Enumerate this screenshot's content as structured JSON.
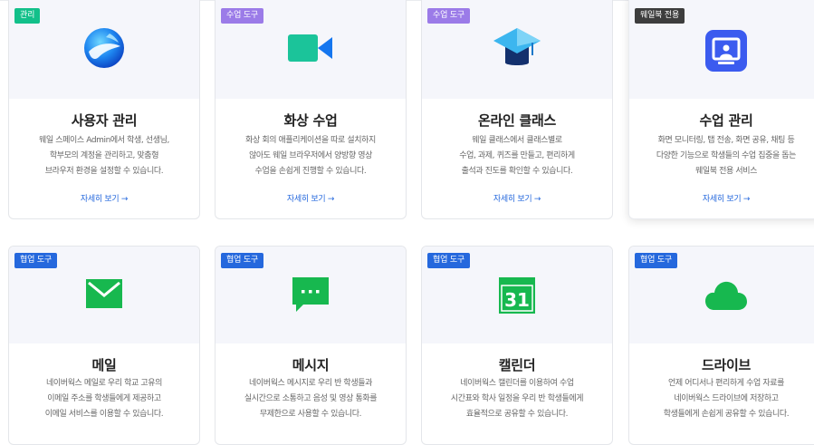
{
  "colors": {
    "badge_green": "#12c08a",
    "badge_purple": "#9b7be8",
    "badge_dark": "#3d3d3d",
    "badge_blue": "#2568dd",
    "link": "#2568dd",
    "green_icon": "#17b84f",
    "zoom_teal": "#1bc49a",
    "zoom_blue": "#1576ef",
    "classroom_blue": "#3cb6ef",
    "classroom_navy": "#13306d",
    "monitor_blue": "#3b5bef"
  },
  "cards_top": [
    {
      "badge": "관리",
      "icon": "whale-icon",
      "title": "사용자 관리",
      "desc": [
        "웨일 스페이스 Admin에서 학생, 선생님,",
        "학부모의 계정을 관리하고, 맞춤형",
        "브라우저 환경을 설정할 수 있습니다."
      ],
      "more": "자세히 보기 →"
    },
    {
      "badge": "수업 도구",
      "icon": "video-camera-icon",
      "title": "화상 수업",
      "desc": [
        "화상 회의 애플리케이션을 따로 설치하지",
        "않아도 웨일 브라우저에서 양방향 영상",
        "수업을 손쉽게 진행할 수 있습니다."
      ],
      "more": "자세히 보기 →"
    },
    {
      "badge": "수업 도구",
      "icon": "graduation-cap-icon",
      "title": "온라인 클래스",
      "desc": [
        "웨일 클래스에서 클래스별로",
        "수업, 과제, 퀴즈를 만들고, 편리하게",
        "출석과 진도를 확인할 수 있습니다."
      ],
      "more": "자세히 보기 →"
    },
    {
      "badge": "웨일북 전용",
      "icon": "monitor-presenter-icon",
      "title": "수업 관리",
      "desc": [
        "화면 모니터링, 탭 전송, 화면 공유, 채팅 등",
        "다양한 기능으로 학생들의 수업 집중을 돕는",
        "웨일북 전용 서비스"
      ],
      "more": "자세히 보기 →"
    }
  ],
  "cards_bottom": [
    {
      "badge": "협업 도구",
      "icon": "mail-icon",
      "title": "메일",
      "desc": [
        "네이버웍스 메일로 우리 학교 고유의",
        "이메일 주소를 학생들에게 제공하고",
        "이메일 서비스를 이용할 수 있습니다."
      ]
    },
    {
      "badge": "협업 도구",
      "icon": "message-bubble-icon",
      "title": "메시지",
      "desc": [
        "네이버웍스 메시지로 우리 반 학생들과",
        "실시간으로 소통하고 음성 및 영상 통화를",
        "무제한으로 사용할 수 있습니다."
      ]
    },
    {
      "badge": "협업 도구",
      "icon": "calendar-icon",
      "calendar_day": "31",
      "title": "캘린더",
      "desc": [
        "네이버웍스 캘린더를 이용하여 수업",
        "시간표와 학사 일정을 우리 반 학생들에게",
        "효율적으로 공유할 수 있습니다."
      ]
    },
    {
      "badge": "협업 도구",
      "icon": "cloud-icon",
      "title": "드라이브",
      "desc": [
        "언제 어디서나 편리하게 수업 자료를",
        "네이버웍스 드라이브에 저장하고",
        "학생들에게 손쉽게 공유할 수 있습니다."
      ]
    }
  ]
}
